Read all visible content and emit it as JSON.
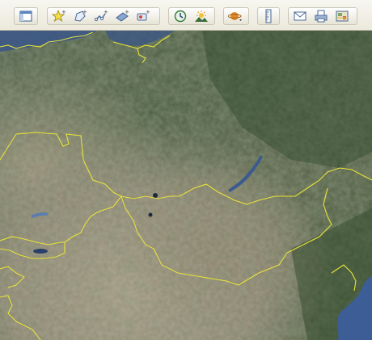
{
  "toolbar": {
    "groups": [
      {
        "id": "sidebar",
        "buttons": [
          "sidebar-toggle-icon"
        ]
      },
      {
        "id": "add",
        "buttons": [
          "add-placemark-icon",
          "add-polygon-icon",
          "add-path-icon",
          "add-image-overlay-icon",
          "record-tour-icon"
        ]
      },
      {
        "id": "view",
        "buttons": [
          "historical-imagery-icon",
          "sunlight-icon"
        ]
      },
      {
        "id": "planets",
        "buttons": [
          "planets-icon"
        ]
      },
      {
        "id": "ruler",
        "buttons": [
          "ruler-icon"
        ]
      },
      {
        "id": "share",
        "buttons": [
          "email-icon",
          "print-icon",
          "view-in-maps-icon"
        ]
      }
    ]
  },
  "colors": {
    "border_line": "#e8e23a",
    "water": "#3d5d96",
    "land_dark": "#3e5232",
    "land_mid": "#6b6a4e",
    "desert": "#9a8e77"
  }
}
